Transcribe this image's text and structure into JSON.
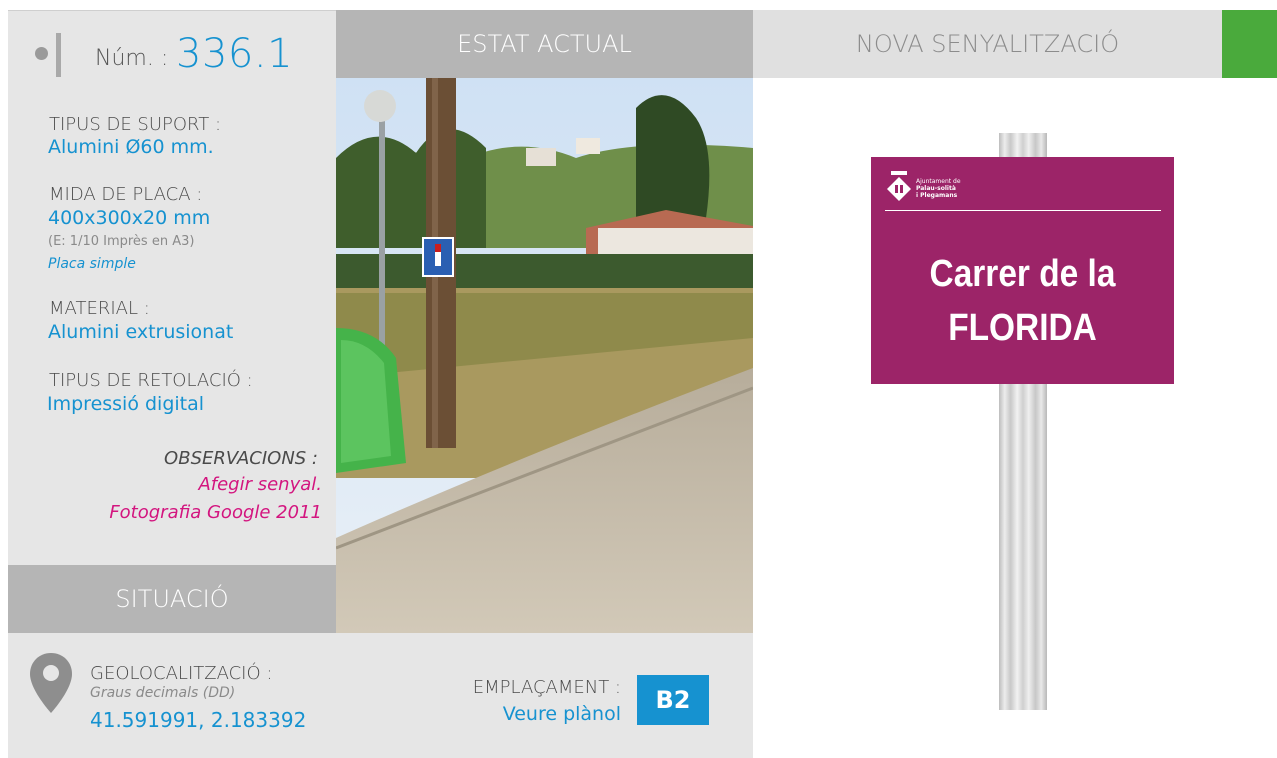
{
  "header": {
    "num_label": "Núm. :",
    "num_value": "336.1",
    "current_state": "ESTAT ACTUAL",
    "new_signage": "NOVA SENYALITZACIÓ"
  },
  "specs": {
    "support_label": "TIPUS DE SUPORT :",
    "support_value": "Alumini Ø60 mm.",
    "plate_label": "MIDA DE PLACA :",
    "plate_value": "400x300x20 mm",
    "plate_scale": "(E: 1/10 Imprès en A3)",
    "plate_type": "Placa simple",
    "material_label": "MATERIAL :",
    "material_value": "Alumini extrusionat",
    "lettering_label": "TIPUS DE RETOLACIÓ :",
    "lettering_value": "Impressió digital",
    "observations_label": "OBSERVACIONS :",
    "observations_line1": "Afegir senyal.",
    "observations_line2": "Fotografia Google 2011"
  },
  "location": {
    "section_title": "SITUACIÓ",
    "geo_label": "GEOLOCALITZACIÓ :",
    "geo_format": "Graus decimals (DD)",
    "geo_value": "41.591991, 2.183392",
    "placement_label": "EMPLAÇAMENT :",
    "placement_link": "Veure plànol",
    "placement_code": "B2"
  },
  "sign": {
    "logo_line1": "Ajuntament de",
    "logo_line2": "Palau-solità",
    "logo_line3": "i Plegamans",
    "street_line1": "Carrer de la",
    "street_line2": "FLORIDA",
    "color": "#9c2468"
  },
  "colors": {
    "accent_blue": "#1692d0",
    "accent_magenta": "#d3157f",
    "status_green": "#4aaa3c"
  },
  "icons": {
    "location": "map-pin-icon",
    "logo": "municipal-shield-icon"
  }
}
